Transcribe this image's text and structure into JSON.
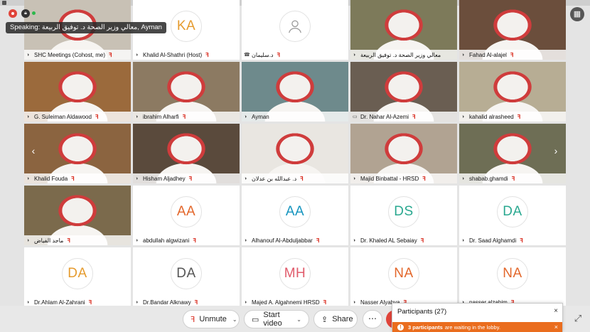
{
  "speaking": "Speaking: معالي وزير الصحة د. توفيق الربيعة, Ayman",
  "participants": [
    {
      "name": "SHC Meetings (Cohost, me)",
      "kind": "video",
      "bg": "#c8c1b5",
      "icon": "mic-icon",
      "muted": true
    },
    {
      "name": "Khalid Al-Shathri (Host)",
      "kind": "avatar",
      "initials": "KA",
      "color": "#e59b2e",
      "icon": "mic-icon",
      "muted": true
    },
    {
      "name": "د.سليمان",
      "kind": "avatar",
      "initials": "",
      "color": "#999",
      "icon": "phone-icon",
      "muted": true
    },
    {
      "name": "معالي وزير الصحة د. توفيق الربيعة",
      "kind": "video",
      "bg": "#7d7a5a",
      "icon": "mic-icon",
      "muted": false,
      "active": true
    },
    {
      "name": "Fahad Al-alajel",
      "kind": "video",
      "bg": "#6b4e3c",
      "icon": "mic-icon",
      "muted": true
    },
    {
      "name": "G. Suleiman Aldawood",
      "kind": "video",
      "bg": "#9b6a3c",
      "icon": "mic-icon",
      "muted": true
    },
    {
      "name": "ibrahim Alharfi",
      "kind": "video",
      "bg": "#8c7a62",
      "icon": "mic-icon",
      "muted": true
    },
    {
      "name": "Ayman",
      "kind": "video",
      "bg": "#6e8a8c",
      "icon": "mic-icon",
      "muted": false,
      "active": true
    },
    {
      "name": "Dr. Nahar Al-Azemi",
      "kind": "video",
      "bg": "#6a5e52",
      "icon": "screen-icon",
      "muted": true
    },
    {
      "name": "kahalid alrasheed",
      "kind": "video",
      "bg": "#b7ad94",
      "icon": "mic-icon",
      "muted": true
    },
    {
      "name": "Khalid Fouda",
      "kind": "video",
      "bg": "#8b6440",
      "icon": "mic-icon",
      "muted": true
    },
    {
      "name": "Hisham Aljadhey",
      "kind": "video",
      "bg": "#5a4a3c",
      "icon": "mic-icon",
      "muted": true
    },
    {
      "name": "د. عبدالله بن عدلان",
      "kind": "video",
      "bg": "#e9e6e1",
      "icon": "mic-icon",
      "muted": true
    },
    {
      "name": "Majid Binbattal - HRSD",
      "kind": "video",
      "bg": "#b1a392",
      "icon": "mic-icon",
      "muted": true
    },
    {
      "name": "shabab.ghamdi",
      "kind": "video",
      "bg": "#6e6e55",
      "icon": "mic-icon",
      "muted": true
    },
    {
      "name": "ماجد الفياض",
      "kind": "video",
      "bg": "#7b6a4c",
      "icon": "mic-icon",
      "muted": true
    },
    {
      "name": "abdullah algwizani",
      "kind": "avatar",
      "initials": "AA",
      "color": "#e3672b",
      "icon": "mic-icon",
      "muted": true
    },
    {
      "name": "Alhanouf Al-Abduljabbar",
      "kind": "avatar",
      "initials": "AA",
      "color": "#1795bf",
      "icon": "mic-icon",
      "muted": true
    },
    {
      "name": "Dr. Khaled AL Sebaiay",
      "kind": "avatar",
      "initials": "DS",
      "color": "#2aa890",
      "icon": "mic-icon",
      "muted": true
    },
    {
      "name": "Dr. Saad Alghamdi",
      "kind": "avatar",
      "initials": "DA",
      "color": "#2aa890",
      "icon": "mic-icon",
      "muted": true
    },
    {
      "name": "Dr.Ahlam Al-Zahrani",
      "kind": "avatar",
      "initials": "DA",
      "color": "#e59b2e",
      "icon": "mic-icon",
      "muted": true
    },
    {
      "name": "Dr.Bandar Alknawy",
      "kind": "avatar",
      "initials": "DA",
      "color": "#555555",
      "icon": "mic-icon",
      "muted": true
    },
    {
      "name": "Majed A. Algahnemi HRSD",
      "kind": "avatar",
      "initials": "MH",
      "color": "#e05b6b",
      "icon": "mic-icon",
      "muted": true
    },
    {
      "name": "Nasser Alyahya",
      "kind": "avatar",
      "initials": "NA",
      "color": "#e3672b",
      "icon": "mic-icon",
      "muted": true
    },
    {
      "name": "nasser alzahim",
      "kind": "avatar",
      "initials": "NA",
      "color": "#e3672b",
      "icon": "mic-icon",
      "muted": true
    }
  ],
  "controls": {
    "unmute": "Unmute",
    "start_video": "Start video",
    "share": "Share",
    "more": "⋯"
  },
  "panel": {
    "title": "Participants (27)",
    "lobby_count": "3 participants",
    "lobby_text": "are waiting in the lobby."
  },
  "glyphs": {
    "mic_off": "ꟻ",
    "close": "×",
    "chevron_left": "‹",
    "chevron_right": "›"
  }
}
